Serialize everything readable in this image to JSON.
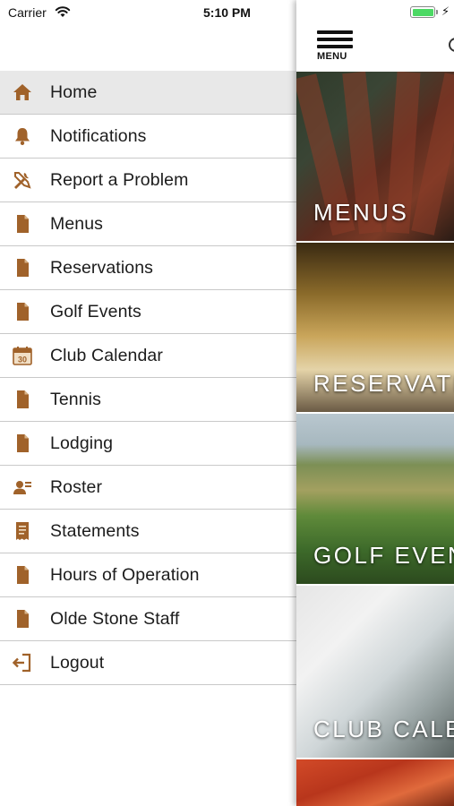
{
  "status_bar": {
    "carrier": "Carrier",
    "time": "5:10 PM",
    "battery_level": 1.0
  },
  "colors": {
    "accent_icon": "#a0622a",
    "active_row_bg": "#e8e8e8",
    "divider": "#c9c9c9",
    "battery_green": "#4cd964"
  },
  "header": {
    "menu_button_label": "MENU"
  },
  "drawer": {
    "items": [
      {
        "label": "Home",
        "icon": "home-icon",
        "active": true
      },
      {
        "label": "Notifications",
        "icon": "bell-icon",
        "active": false
      },
      {
        "label": "Report a Problem",
        "icon": "tools-icon",
        "active": false
      },
      {
        "label": "Menus",
        "icon": "document-icon",
        "active": false
      },
      {
        "label": "Reservations",
        "icon": "document-icon",
        "active": false
      },
      {
        "label": "Golf Events",
        "icon": "document-icon",
        "active": false
      },
      {
        "label": "Club Calendar",
        "icon": "calendar-icon",
        "active": false
      },
      {
        "label": "Tennis",
        "icon": "document-icon",
        "active": false
      },
      {
        "label": "Lodging",
        "icon": "document-icon",
        "active": false
      },
      {
        "label": "Roster",
        "icon": "roster-icon",
        "active": false
      },
      {
        "label": "Statements",
        "icon": "statement-icon",
        "active": false
      },
      {
        "label": "Hours of Operation",
        "icon": "document-icon",
        "active": false
      },
      {
        "label": "Olde Stone Staff",
        "icon": "document-icon",
        "active": false
      },
      {
        "label": "Logout",
        "icon": "logout-icon",
        "active": false
      }
    ],
    "calendar_icon_day": "30"
  },
  "tiles": {
    "menus": "MENUS",
    "reservations": "RESERVATI",
    "golf_events": "GOLF EVEN",
    "club_calendar": "CLUB CALE"
  }
}
